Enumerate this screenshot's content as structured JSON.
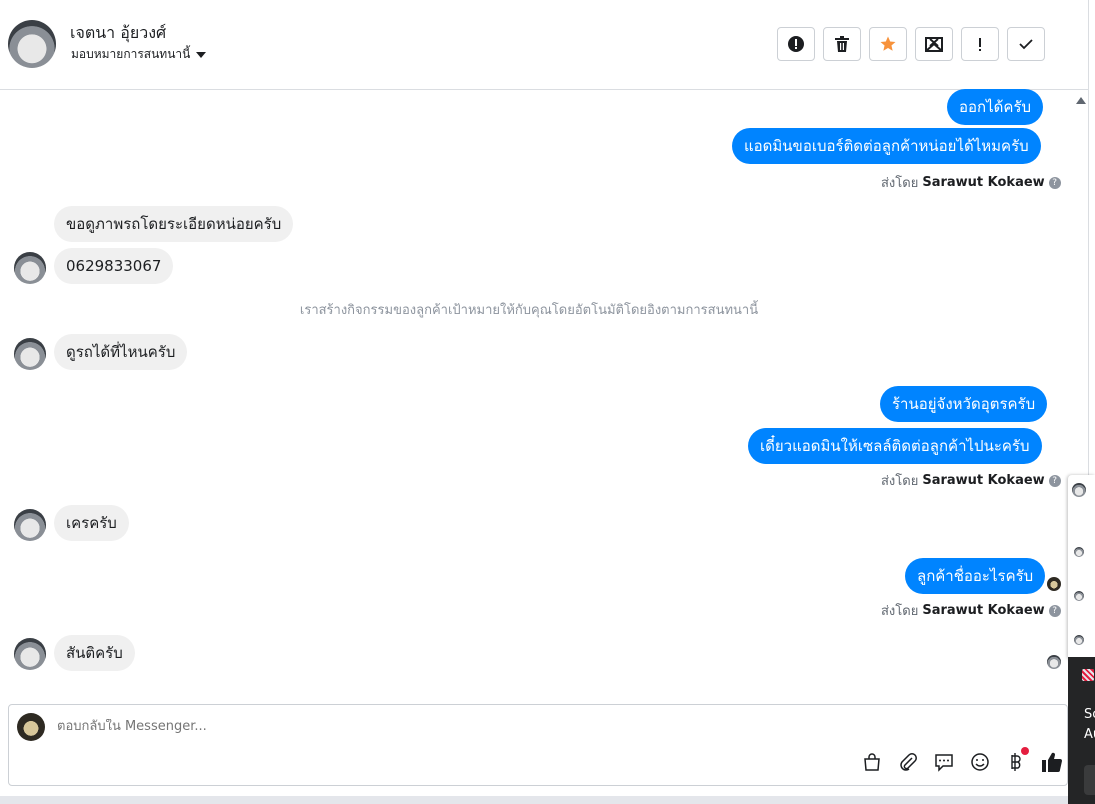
{
  "header": {
    "contact_name": "เจตนา อุ้ยวงศ์",
    "assign_label": "มอบหมายการสนทนานี้",
    "toolbar": [
      {
        "name": "report-button",
        "icon": "exclamation-circle-icon"
      },
      {
        "name": "delete-button",
        "icon": "trash-icon"
      },
      {
        "name": "star-button",
        "icon": "star-icon"
      },
      {
        "name": "mark-unread-button",
        "icon": "envelope-x-icon"
      },
      {
        "name": "follow-up-button",
        "icon": "exclamation-icon"
      },
      {
        "name": "mark-done-button",
        "icon": "check-icon"
      }
    ]
  },
  "messages": {
    "m1": "ออกได้ครับ",
    "m2": "แอดมินขอเบอร์ติดต่อลูกค้าหน่อยได้ไหมครับ",
    "m3": "ขอดูภาพรถโดยระเอียดหน่อยครับ",
    "m4": "0629833067",
    "m5": "ดูรถได้ที่ไหนครับ",
    "m6": "ร้านอยู่จังหวัดอุตรครับ",
    "m7": "เดี๋ยวแอดมินให้เซลล์ติดต่อลูกค้าไปนะครับ",
    "m8": "เครครับ",
    "m9": "ลูกค้าชื่ออะไรครับ",
    "m10": "สันติครับ"
  },
  "sent_by": {
    "prefix": "ส่งโดย",
    "name": "Sarawut Kokaew",
    "help": "?"
  },
  "system_text": "เราสร้างกิจกรรมของลูกค้าเป้าหมายให้กับคุณโดยอัตโนมัติโดยอิงตามการสนทนานี้",
  "composer": {
    "placeholder": "ตอบกลับใน Messenger...",
    "icons": [
      "shopping-bag-icon",
      "paperclip-icon",
      "saved-replies-icon",
      "emoji-icon",
      "baht-payment-icon",
      "thumbs-up-icon"
    ]
  },
  "side_panel": {
    "line1": "Sc",
    "line2": "Au"
  },
  "colors": {
    "outgoing_bubble": "#0084ff",
    "incoming_bubble": "#f0f0f0",
    "star": "#f7923b"
  }
}
